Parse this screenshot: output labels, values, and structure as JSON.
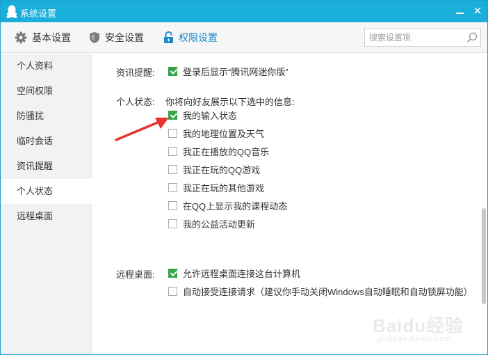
{
  "window": {
    "title": "系统设置"
  },
  "toolbar": {
    "tabs": [
      {
        "label": "基本设置",
        "icon": "gear-icon"
      },
      {
        "label": "安全设置",
        "icon": "shield-icon"
      },
      {
        "label": "权限设置",
        "icon": "lock-icon",
        "active": true
      }
    ],
    "search_placeholder": "搜索设置项"
  },
  "sidebar": {
    "items": [
      {
        "label": "个人资料"
      },
      {
        "label": "空间权限"
      },
      {
        "label": "防骚扰"
      },
      {
        "label": "临时会话"
      },
      {
        "label": "资讯提醒"
      },
      {
        "label": "个人状态",
        "active": true
      },
      {
        "label": "远程桌面"
      }
    ]
  },
  "content": {
    "news_reminder": {
      "label": "资讯提醒:",
      "option": {
        "label": "登录后显示“腾讯网迷你版”",
        "checked": true
      }
    },
    "personal_status": {
      "label": "个人状态:",
      "hint": "你将向好友展示以下选中的信息:",
      "options": [
        {
          "label": "我的输入状态",
          "checked": true
        },
        {
          "label": "我的地理位置及天气",
          "checked": false
        },
        {
          "label": "我正在播放的QQ音乐",
          "checked": false
        },
        {
          "label": "我正在玩的QQ游戏",
          "checked": false
        },
        {
          "label": "我正在玩的其他游戏",
          "checked": false
        },
        {
          "label": "在QQ上显示我的课程动态",
          "checked": false
        },
        {
          "label": "我的公益活动更新",
          "checked": false
        }
      ]
    },
    "remote_desktop": {
      "label": "远程桌面:",
      "options": [
        {
          "label": "允许远程桌面连接这台计算机",
          "checked": true
        },
        {
          "label": "自动接受连接请求（建议你手动关闭Windows自动睡眠和自动锁屏功能）",
          "checked": false
        }
      ]
    }
  },
  "watermark": {
    "main": "Baidu经验",
    "sub": "jingyan.baidu.com"
  },
  "colors": {
    "titlebar": "#1aaedb",
    "accent": "#1a87d0",
    "check": "#35a34a",
    "arrow": "#e8332f"
  }
}
